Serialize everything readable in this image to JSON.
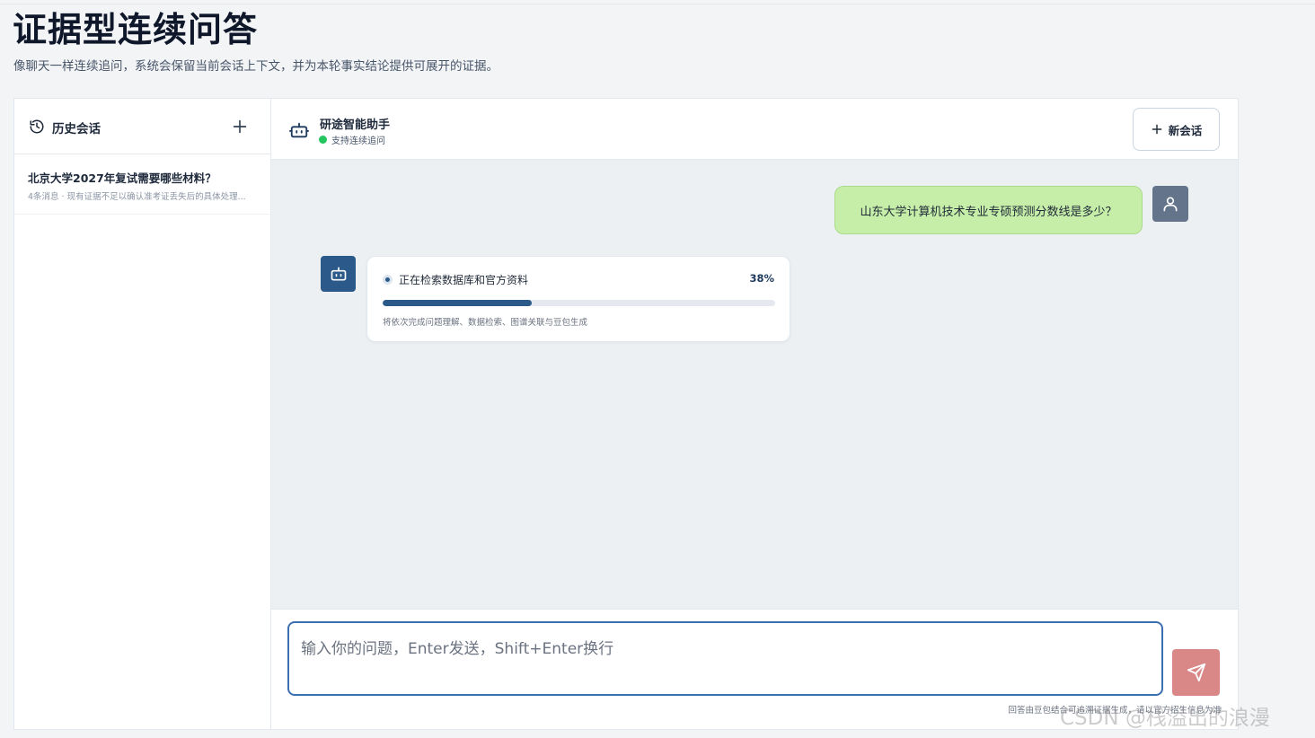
{
  "page": {
    "title": "证据型连续问答",
    "subtitle": "像聊天一样连续追问，系统会保留当前会话上下文，并为本轮事实结论提供可展开的证据。"
  },
  "sidebar": {
    "title": "历史会话",
    "history_icon": "history-icon",
    "add_icon": "plus-icon",
    "sessions": [
      {
        "title": "北京大学2027年复试需要哪些材料？",
        "meta": "4条消息 · 现有证据不足以确认准考证丢失后的具体处理..."
      }
    ]
  },
  "chat": {
    "assistant_name": "研途智能助手",
    "status_text": "支持连续追问",
    "status_color": "#22c55e",
    "new_session_label": "新会话",
    "messages": {
      "user_question": "山东大学计算机技术专业专硕预测分数线是多少？",
      "progress": {
        "label": "正在检索数据库和官方资料",
        "percent_text": "38%",
        "percent": 38,
        "hint": "将依次完成问题理解、数据检索、图谱关联与豆包生成"
      }
    },
    "composer": {
      "placeholder": "输入你的问题，Enter发送，Shift+Enter换行",
      "value": "",
      "send_icon": "send-icon",
      "disclaimer": "回答由豆包结合可追溯证据生成，请以官方招生信息为准"
    }
  },
  "colors": {
    "accent": "#2b5a8a",
    "user_bubble": "#c6eea9",
    "send_button": "#d98787",
    "input_border": "#3b6fb0"
  },
  "watermark": "CSDN @栈溢出的浪漫"
}
